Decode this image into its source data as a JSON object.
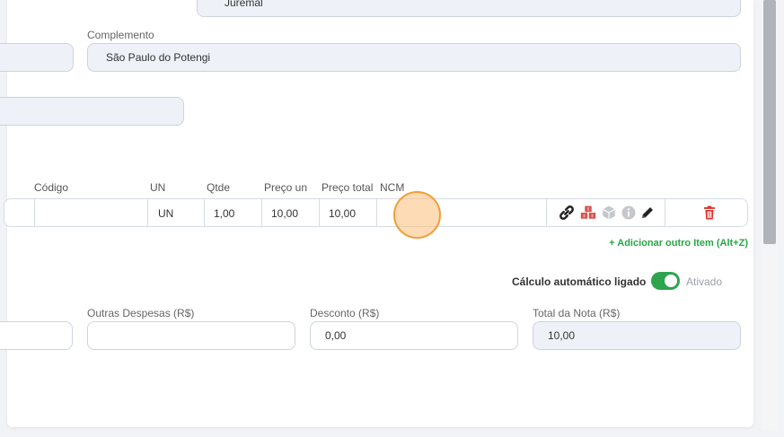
{
  "address": {
    "bairro_value": "Juremal",
    "complemento_label": "Complemento",
    "complemento_value": "São Paulo do Potengi"
  },
  "items": {
    "headers": {
      "codigo": "Código",
      "un": "UN",
      "qtde": "Qtde",
      "preco_un": "Preço un",
      "preco_total": "Preço total",
      "ncm": "NCM"
    },
    "row": {
      "codigo": "",
      "un": "UN",
      "qtde": "1,00",
      "preco_un": "10,00",
      "preco_total": "10,00",
      "ncm": ""
    },
    "row_icons": [
      "link-icon",
      "cubes-icon",
      "box-icon",
      "info-icon",
      "pencil-icon",
      "trash-icon"
    ],
    "add_item_label": "+ Adicionar outro Item (Alt+Z)"
  },
  "totals": {
    "calc_label": "Cálculo automático ligado",
    "calc_state": "Ativado",
    "calc_enabled": true,
    "outras_despesas_label": "Outras Despesas (R$)",
    "outras_despesas_value": "",
    "desconto_label": "Desconto (R$)",
    "desconto_value": "0,00",
    "total_nota_label": "Total da Nota (R$)",
    "total_nota_value": "10,00"
  },
  "colors": {
    "accent_green": "#2ea44f",
    "danger_red": "#e0322f",
    "cubes_red": "#d9534f",
    "icon_gray": "#c4c7cc"
  }
}
